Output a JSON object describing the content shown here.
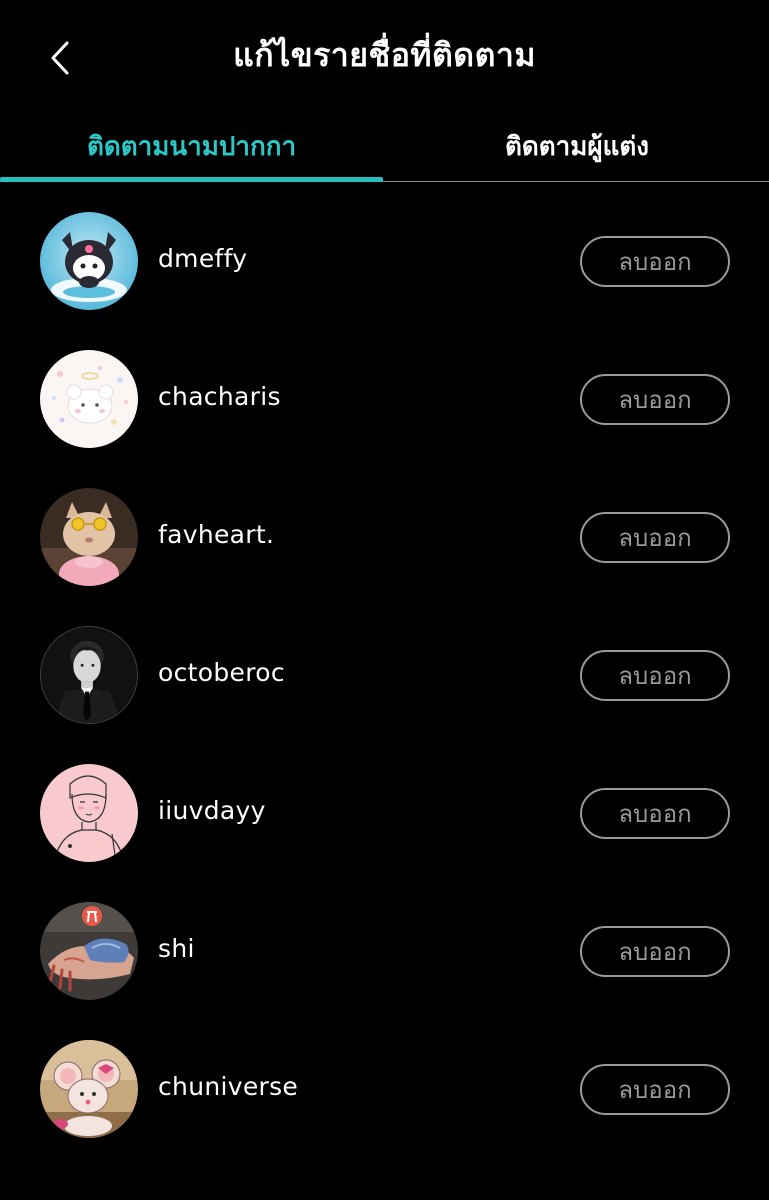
{
  "header": {
    "title": "แก้ไขรายชื่อที่ติดตาม",
    "back_icon": "chevron-left-icon"
  },
  "tabs": [
    {
      "label": "ติดตามนามปากกา",
      "active": true
    },
    {
      "label": "ติดตามผู้แต่ง",
      "active": false
    }
  ],
  "colors": {
    "accent": "#25c1c1",
    "background": "#000000",
    "button_border": "#9a9a9a"
  },
  "list": {
    "remove_label": "ลบออก",
    "items": [
      {
        "username": "dmeffy",
        "avatar": "kuromi-avatar"
      },
      {
        "username": "chacharis",
        "avatar": "pastel-bear-avatar"
      },
      {
        "username": "favheart.",
        "avatar": "cat-sunglasses-avatar"
      },
      {
        "username": "octoberoc",
        "avatar": "man-portrait-avatar"
      },
      {
        "username": "iiuvdayy",
        "avatar": "sketch-boy-avatar"
      },
      {
        "username": "shi",
        "avatar": "hands-avatar"
      },
      {
        "username": "chuniverse",
        "avatar": "cartoon-mouse-avatar"
      }
    ]
  }
}
